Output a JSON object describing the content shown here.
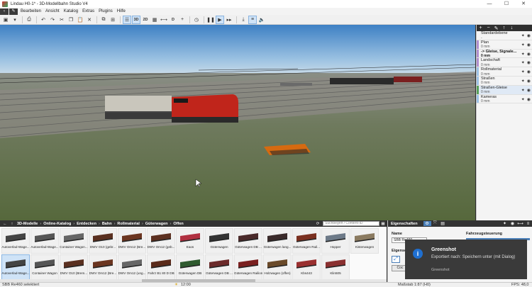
{
  "window": {
    "title": "Lindau H0-1* - 3D-Modellbahn Studio V4",
    "controls": [
      "—",
      "☐",
      "✕"
    ]
  },
  "menubar": {
    "items": [
      "Bearbeiten",
      "Ansicht",
      "Katalog",
      "Extras",
      "Plugins",
      "Hilfe"
    ]
  },
  "toolbar": {
    "view_3d": "3D",
    "view_2d": "2D",
    "label_d": "D"
  },
  "layers": {
    "items": [
      {
        "name": "Standardebene",
        "sub": "-",
        "color": "#f4f4f4"
      },
      {
        "name": "Plan",
        "sub": "0 mm",
        "color": "#b08fd0"
      },
      {
        "name": "-> Gleise, Signale...",
        "sub": "0 mm",
        "color": "#b08fd0",
        "bold": true
      },
      {
        "name": "Landschaft",
        "sub": "0 mm",
        "color": "#b08fd0"
      },
      {
        "name": "Rollmaterial",
        "sub": "0 mm",
        "color": "#9ec3e8"
      },
      {
        "name": "Straßen",
        "sub": "0 mm",
        "color": "#9ec3e8"
      },
      {
        "name": "Straßen-Gleise",
        "sub": "0 mm",
        "color": "#57a05a",
        "selected": true
      },
      {
        "name": "Kameras",
        "sub": "0 mm",
        "color": "#9ec3e8"
      }
    ]
  },
  "catalog": {
    "breadcrumb": [
      "3D-Modelle",
      "Online-Katalog",
      "Entdecken",
      "Bahn",
      "Rollmaterial",
      "Güterwagen",
      "Offen"
    ],
    "search_placeholder": "Suchbegriff / Content-ID",
    "items": [
      {
        "label": "Autoverlad-Wage...",
        "color": "#444"
      },
      {
        "label": "Autoverlad-Wage...",
        "color": "#555"
      },
      {
        "label": "Container Wagon...",
        "color": "#666"
      },
      {
        "label": "DWV O10 (gebr...",
        "color": "#5a3020"
      },
      {
        "label": "DWV Om12 (Bre...",
        "color": "#6b3520"
      },
      {
        "label": "DWV Om12 (geb...",
        "color": "#5c3020"
      },
      {
        "label": "Eaos",
        "color": "#b03040"
      },
      {
        "label": "Güterwagen",
        "color": "#333"
      },
      {
        "label": "Güterwagen DB ...",
        "color": "#4a2a2a"
      },
      {
        "label": "Güterwagen lang...",
        "color": "#3a2a2a"
      },
      {
        "label": "Güterwagen Rail...",
        "color": "#7a3020"
      },
      {
        "label": "Hopper",
        "color": "#6d7a88"
      },
      {
        "label": "Kistenwagen",
        "color": "#8a7a60"
      },
      {
        "label": "Autoverlad-Wage...",
        "color": "#444",
        "selected": true
      },
      {
        "label": "Container Wagon",
        "color": "#555"
      },
      {
        "label": "DWV O10 (Brem...",
        "color": "#5a3020"
      },
      {
        "label": "DWV Om12 (Bre...",
        "color": "#6b3520"
      },
      {
        "label": "DWV Om12 (ung...",
        "color": "#666"
      },
      {
        "label": "Fahrz B1 80 D DB",
        "color": "#5a2a1a"
      },
      {
        "label": "Güterwagen DB",
        "color": "#2f5a2f"
      },
      {
        "label": "Güterwagen DB ...",
        "color": "#6b2a2a"
      },
      {
        "label": "Güterwagen Railion",
        "color": "#7a2020"
      },
      {
        "label": "Holzwagen (offen)",
        "color": "#6a4a2a"
      },
      {
        "label": "Kbs443",
        "color": "#9a3030"
      },
      {
        "label": "Klin505",
        "color": "#8a3030"
      }
    ]
  },
  "properties": {
    "title": "Eigenschaften",
    "name_label": "Name",
    "name_value": "SBB Re460",
    "section_label": "Eigenschaften",
    "fahrzeug_label": "Fahrzeugsteuerung",
    "button_label": "Coc"
  },
  "notification": {
    "icon": "i",
    "title": "Greenshot",
    "message": "Exportiert nach: Speichern unter (mit Dialog)",
    "source": "Greenshot"
  },
  "statusbar": {
    "selection": "SBB Re460 selektiert",
    "time": "12:00",
    "scale": "Maßstab 1:87 (H0)",
    "fps": "FPS: 48,0"
  }
}
